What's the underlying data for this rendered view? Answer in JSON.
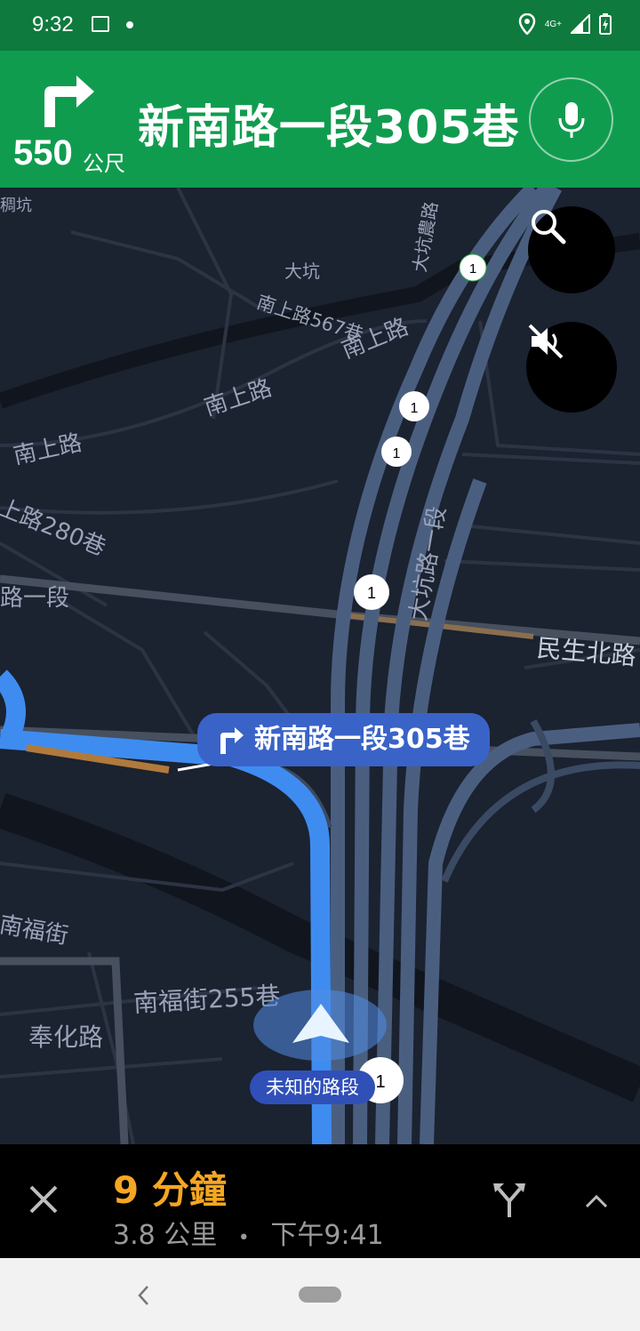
{
  "status_bar": {
    "time": "9:32",
    "network": "4G+"
  },
  "nav_header": {
    "distance_value": "550",
    "distance_unit": "公尺",
    "street": "新南路一段305巷",
    "turn_icon": "turn-right-icon",
    "mic_icon": "mic-icon",
    "bg_color": "#109c4f"
  },
  "map": {
    "labels": {
      "dakeng": "大坑",
      "nanshang567": "南上路567巷",
      "nanshang_a": "南上路",
      "nanshang_b": "南上路",
      "nanshang_c": "南上路",
      "nanshang280": "上路280巷",
      "road1": "路一段",
      "dakeng_farm": "大坑農路",
      "dakeng_road1": "大坑路一段",
      "minsheng": "民生北路",
      "nanfu": "南福街",
      "nanfu255": "南福街255巷",
      "fenghua": "奉化路",
      "top_partial": "稠坑"
    },
    "route_callout": "新南路一段305巷",
    "current_road": "未知的路段",
    "route_shields": [
      "1",
      "1",
      "1",
      "1",
      "1"
    ],
    "buttons": {
      "search_icon": "search-icon",
      "mute_icon": "volume-off-icon"
    }
  },
  "bottom_bar": {
    "eta_minutes": "9 分鐘",
    "distance": "3.8 公里",
    "separator": "•",
    "arrival": "下午9:41",
    "close_icon": "close-icon",
    "alt_route_icon": "alternate-route-icon",
    "expand_icon": "chevron-up-icon",
    "accent_color": "#f5a623"
  }
}
